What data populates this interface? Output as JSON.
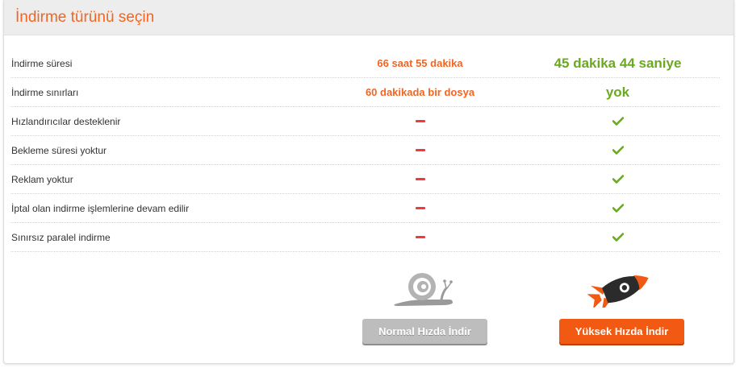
{
  "header": {
    "title": "İndirme türünü seçin"
  },
  "rows": [
    {
      "label": "İndirme süresi",
      "normal": "66 saat 55 dakika",
      "fast": "45 dakika 44 saniye"
    },
    {
      "label": "İndirme sınırları",
      "normal": "60 dakikada bir dosya",
      "fast": "yok"
    },
    {
      "label": "Hızlandırıcılar desteklenir",
      "normal_icon": "dash-icon",
      "fast_icon": "check-icon"
    },
    {
      "label": "Bekleme süresi yoktur",
      "normal_icon": "dash-icon",
      "fast_icon": "check-icon"
    },
    {
      "label": "Reklam yoktur",
      "normal_icon": "dash-icon",
      "fast_icon": "check-icon"
    },
    {
      "label": "İptal olan indirme işlemlerine devam edilir",
      "normal_icon": "dash-icon",
      "fast_icon": "check-icon"
    },
    {
      "label": "Sınırsız paralel indirme",
      "normal_icon": "dash-icon",
      "fast_icon": "check-icon"
    }
  ],
  "buttons": {
    "normal_label": "Normal Hızda İndir",
    "fast_label": "Yüksek Hızda İndir"
  },
  "icons": {
    "normal": "snail-icon",
    "fast": "rocket-icon"
  },
  "colors": {
    "accent": "#f26522",
    "success": "#6aaa1f",
    "negative": "#ef3b3b",
    "button_fast": "#f25a14",
    "button_normal": "#bdbdbd"
  }
}
